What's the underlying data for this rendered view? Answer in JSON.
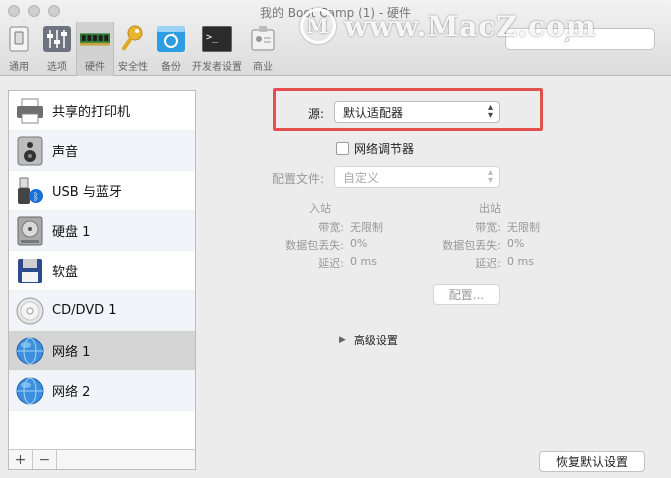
{
  "window": {
    "title": "我的 Boot Camp (1) - 硬件"
  },
  "toolbar": [
    {
      "label": "通用",
      "icon": "switch-icon"
    },
    {
      "label": "选项",
      "icon": "sliders-icon"
    },
    {
      "label": "硬件",
      "icon": "ram-chip-icon"
    },
    {
      "label": "安全性",
      "icon": "key-icon"
    },
    {
      "label": "备份",
      "icon": "backup-icon"
    },
    {
      "label": "开发者设置",
      "icon": "terminal-icon"
    },
    {
      "label": "商业",
      "icon": "badge-icon"
    }
  ],
  "watermark": {
    "text": "www.MacZ.com"
  },
  "sidebar": {
    "items": [
      {
        "label": "共享的打印机",
        "icon": "printer-icon"
      },
      {
        "label": "声音",
        "icon": "speaker-icon"
      },
      {
        "label": "USB 与蓝牙",
        "icon": "usb-bluetooth-icon"
      },
      {
        "label": "硬盘 1",
        "icon": "hard-disk-icon"
      },
      {
        "label": "软盘",
        "icon": "floppy-icon"
      },
      {
        "label": "CD/DVD 1",
        "icon": "cd-icon"
      },
      {
        "label": "网络 1",
        "icon": "globe-icon"
      },
      {
        "label": "网络 2",
        "icon": "globe-icon"
      }
    ],
    "add_label": "+",
    "remove_label": "−"
  },
  "network": {
    "source_label": "源:",
    "source_value": "默认适配器",
    "conditioner_label": "网络调节器",
    "profile_label": "配置文件:",
    "profile_value": "自定义",
    "inbound_header": "入站",
    "outbound_header": "出站",
    "bandwidth_label": "带宽:",
    "packet_loss_label": "数据包丢失:",
    "delay_label": "延迟:",
    "inbound": {
      "bandwidth": "无限制",
      "packet_loss": "0%",
      "delay": "0 ms"
    },
    "outbound": {
      "bandwidth": "无限制",
      "packet_loss": "0%",
      "delay": "0 ms"
    },
    "configure_button": "配置...",
    "advanced_label": "高级设置"
  },
  "footer": {
    "restore_defaults": "恢复默认设置"
  },
  "colors": {
    "highlight": "#e2514d",
    "selected_row": "#d4d4d4"
  }
}
